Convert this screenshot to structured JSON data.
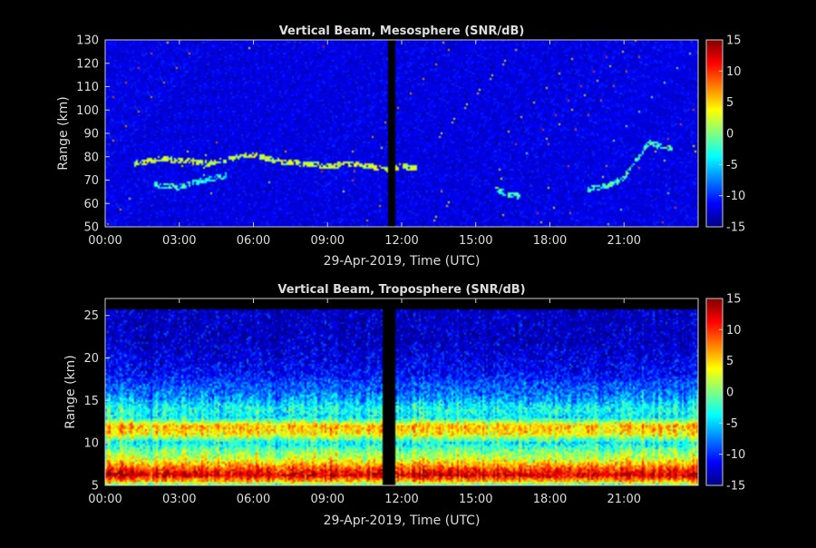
{
  "colors": {
    "background": "#000000",
    "axes": "#cccccc",
    "text": "#dddddd",
    "colormap": "jet"
  },
  "chart_data": [
    {
      "type": "heatmap",
      "title": "Vertical Beam, Mesosphere (SNR/dB)",
      "xlabel": "29-Apr-2019, Time (UTC)",
      "ylabel": "Range (km)",
      "x_ticks": [
        "00:00",
        "03:00",
        "06:00",
        "09:00",
        "12:00",
        "15:00",
        "18:00",
        "21:00"
      ],
      "x_tick_hours": [
        0,
        3,
        6,
        9,
        12,
        15,
        18,
        21
      ],
      "xlim_hours": [
        0,
        24
      ],
      "y_ticks": [
        50,
        60,
        70,
        80,
        90,
        100,
        110,
        120,
        130
      ],
      "ylim": [
        50,
        130
      ],
      "colorbar": {
        "ticks": [
          15,
          10,
          5,
          0,
          -5,
          -10,
          -15
        ],
        "clim": [
          -15,
          15
        ]
      },
      "background_snr_db": -12,
      "data_gaps_hours": [
        [
          11.45,
          11.75
        ],
        [
          13.7,
          13.73
        ]
      ],
      "echo_layers": [
        {
          "time_hours": [
            1.2,
            2.2,
            3.2,
            4.2,
            5.0,
            6.0,
            7.0,
            8.0,
            9.0,
            10.0,
            11.0,
            11.4,
            12.0,
            12.6
          ],
          "range_km": [
            77,
            79,
            78.5,
            77,
            79,
            81,
            78,
            77,
            76,
            77,
            75.5,
            74,
            76,
            75
          ],
          "snr_db": 2
        },
        {
          "time_hours": [
            2.0,
            3.0,
            4.0,
            5.0
          ],
          "range_km": [
            68,
            67,
            70,
            72
          ],
          "snr_db": -3
        },
        {
          "time_hours": [
            15.8,
            16.3,
            16.8
          ],
          "range_km": [
            66,
            64,
            63
          ],
          "snr_db": -2
        },
        {
          "time_hours": [
            19.5,
            20.5,
            21.0,
            22.0,
            23.0
          ],
          "range_km": [
            66,
            68,
            71,
            86,
            83
          ],
          "snr_db": -2
        }
      ]
    },
    {
      "type": "heatmap",
      "title": "Vertical Beam, Troposphere (SNR/dB)",
      "xlabel": "29-Apr-2019, Time (UTC)",
      "ylabel": "Range (km)",
      "x_ticks": [
        "00:00",
        "03:00",
        "06:00",
        "09:00",
        "12:00",
        "15:00",
        "18:00",
        "21:00"
      ],
      "x_tick_hours": [
        0,
        3,
        6,
        9,
        12,
        15,
        18,
        21
      ],
      "xlim_hours": [
        0,
        24
      ],
      "y_ticks": [
        5,
        10,
        15,
        20,
        25
      ],
      "ylim": [
        5,
        27
      ],
      "data_top_km": 25.8,
      "colorbar": {
        "ticks": [
          15,
          10,
          5,
          0,
          -5,
          -10,
          -15
        ],
        "clim": [
          -15,
          15
        ]
      },
      "data_gaps_hours": [
        [
          11.25,
          11.75
        ],
        [
          13.7,
          13.74
        ]
      ],
      "snr_profile": {
        "range_km": [
          5.0,
          5.5,
          6.2,
          7.0,
          8.0,
          9.0,
          10.0,
          11.0,
          12.0,
          13.0,
          14.0,
          15.0,
          16.0,
          17.0,
          18.0,
          20.0,
          22.0,
          25.8
        ],
        "snr_db": [
          -2,
          6,
          13,
          9,
          3,
          0,
          -4,
          4,
          6,
          -4,
          -3,
          -6,
          -8,
          -9,
          -11,
          -12,
          -13,
          -13
        ]
      }
    }
  ]
}
